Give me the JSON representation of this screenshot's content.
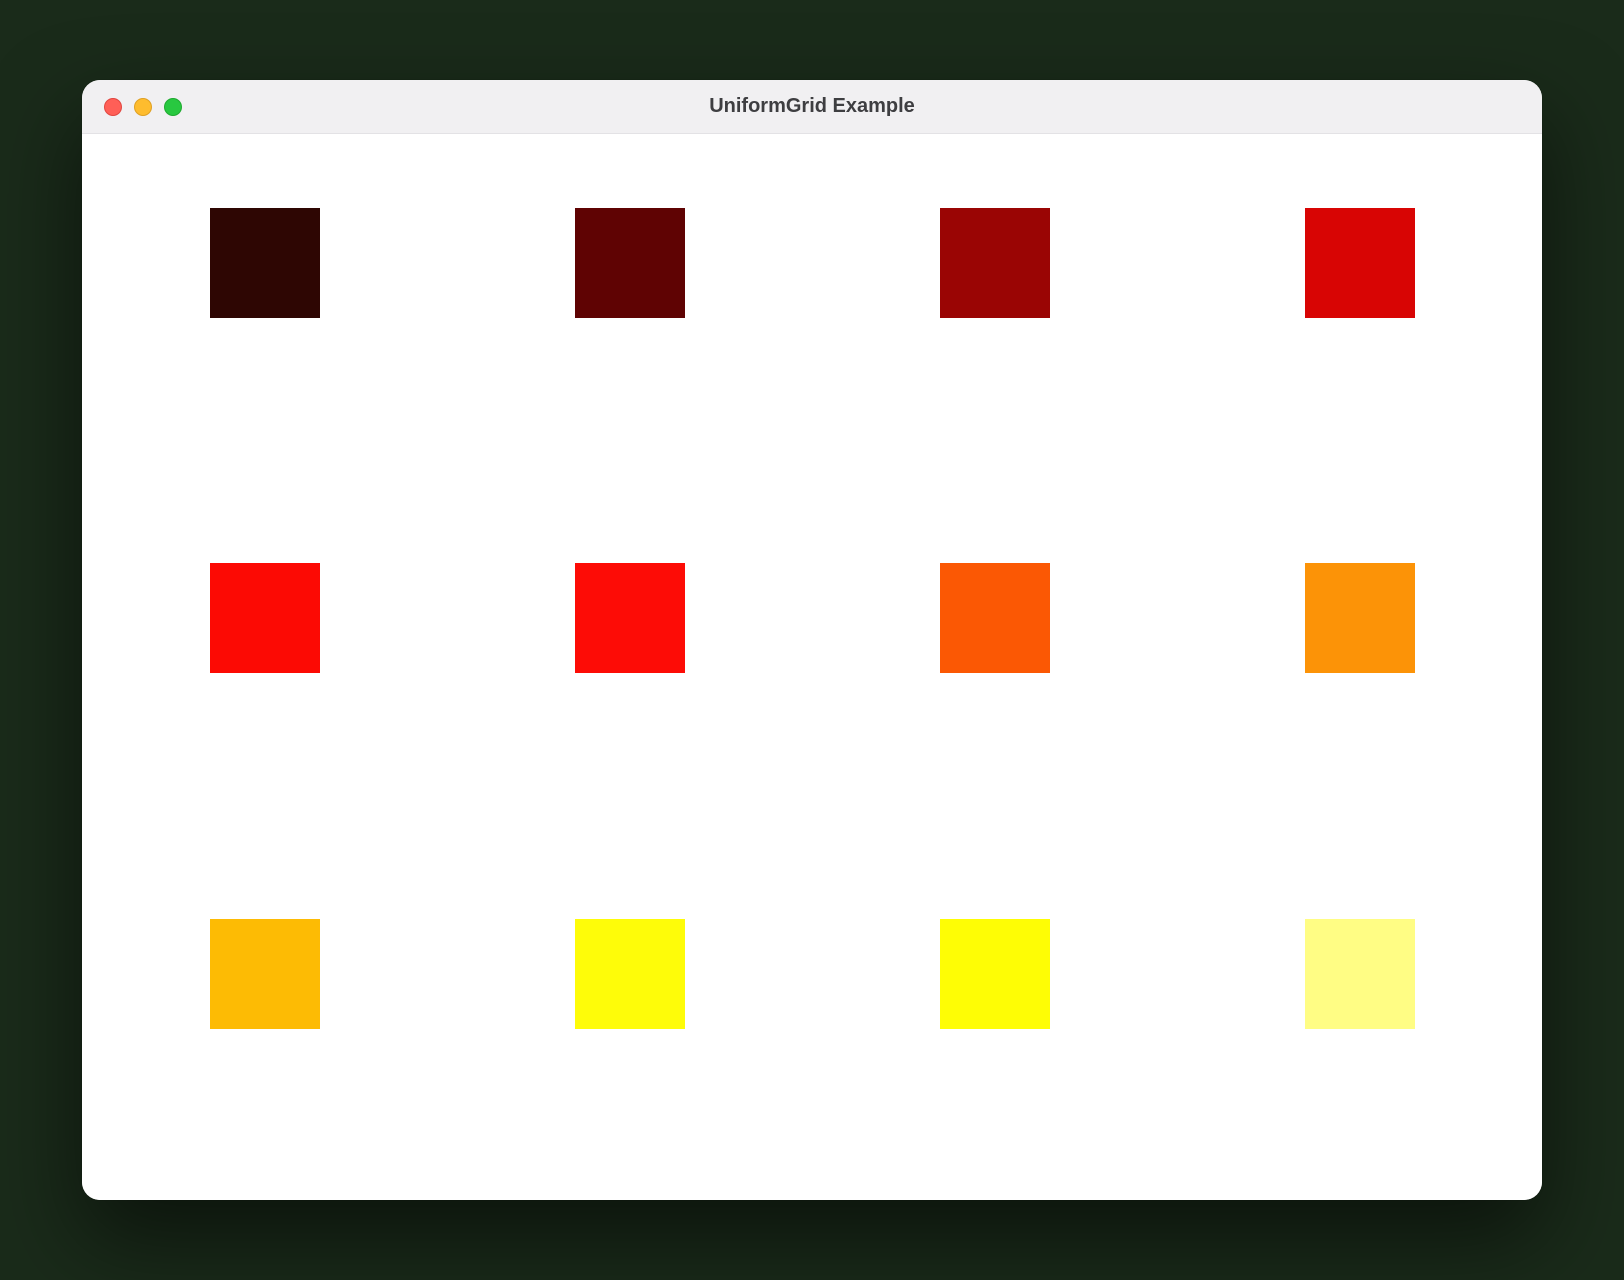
{
  "window": {
    "title": "UniformGrid Example"
  },
  "grid": {
    "columns": 4,
    "rows": 3,
    "swatches": [
      {
        "name": "swatch-0",
        "color": "#2e0603"
      },
      {
        "name": "swatch-1",
        "color": "#5f0303"
      },
      {
        "name": "swatch-2",
        "color": "#9a0504"
      },
      {
        "name": "swatch-3",
        "color": "#d80504"
      },
      {
        "name": "swatch-4",
        "color": "#fc0a04"
      },
      {
        "name": "swatch-5",
        "color": "#fd0c06"
      },
      {
        "name": "swatch-6",
        "color": "#fb5804"
      },
      {
        "name": "swatch-7",
        "color": "#fc9307"
      },
      {
        "name": "swatch-8",
        "color": "#fdbb04"
      },
      {
        "name": "swatch-9",
        "color": "#fefc09"
      },
      {
        "name": "swatch-10",
        "color": "#fefd05"
      },
      {
        "name": "swatch-11",
        "color": "#fffd84"
      }
    ]
  }
}
